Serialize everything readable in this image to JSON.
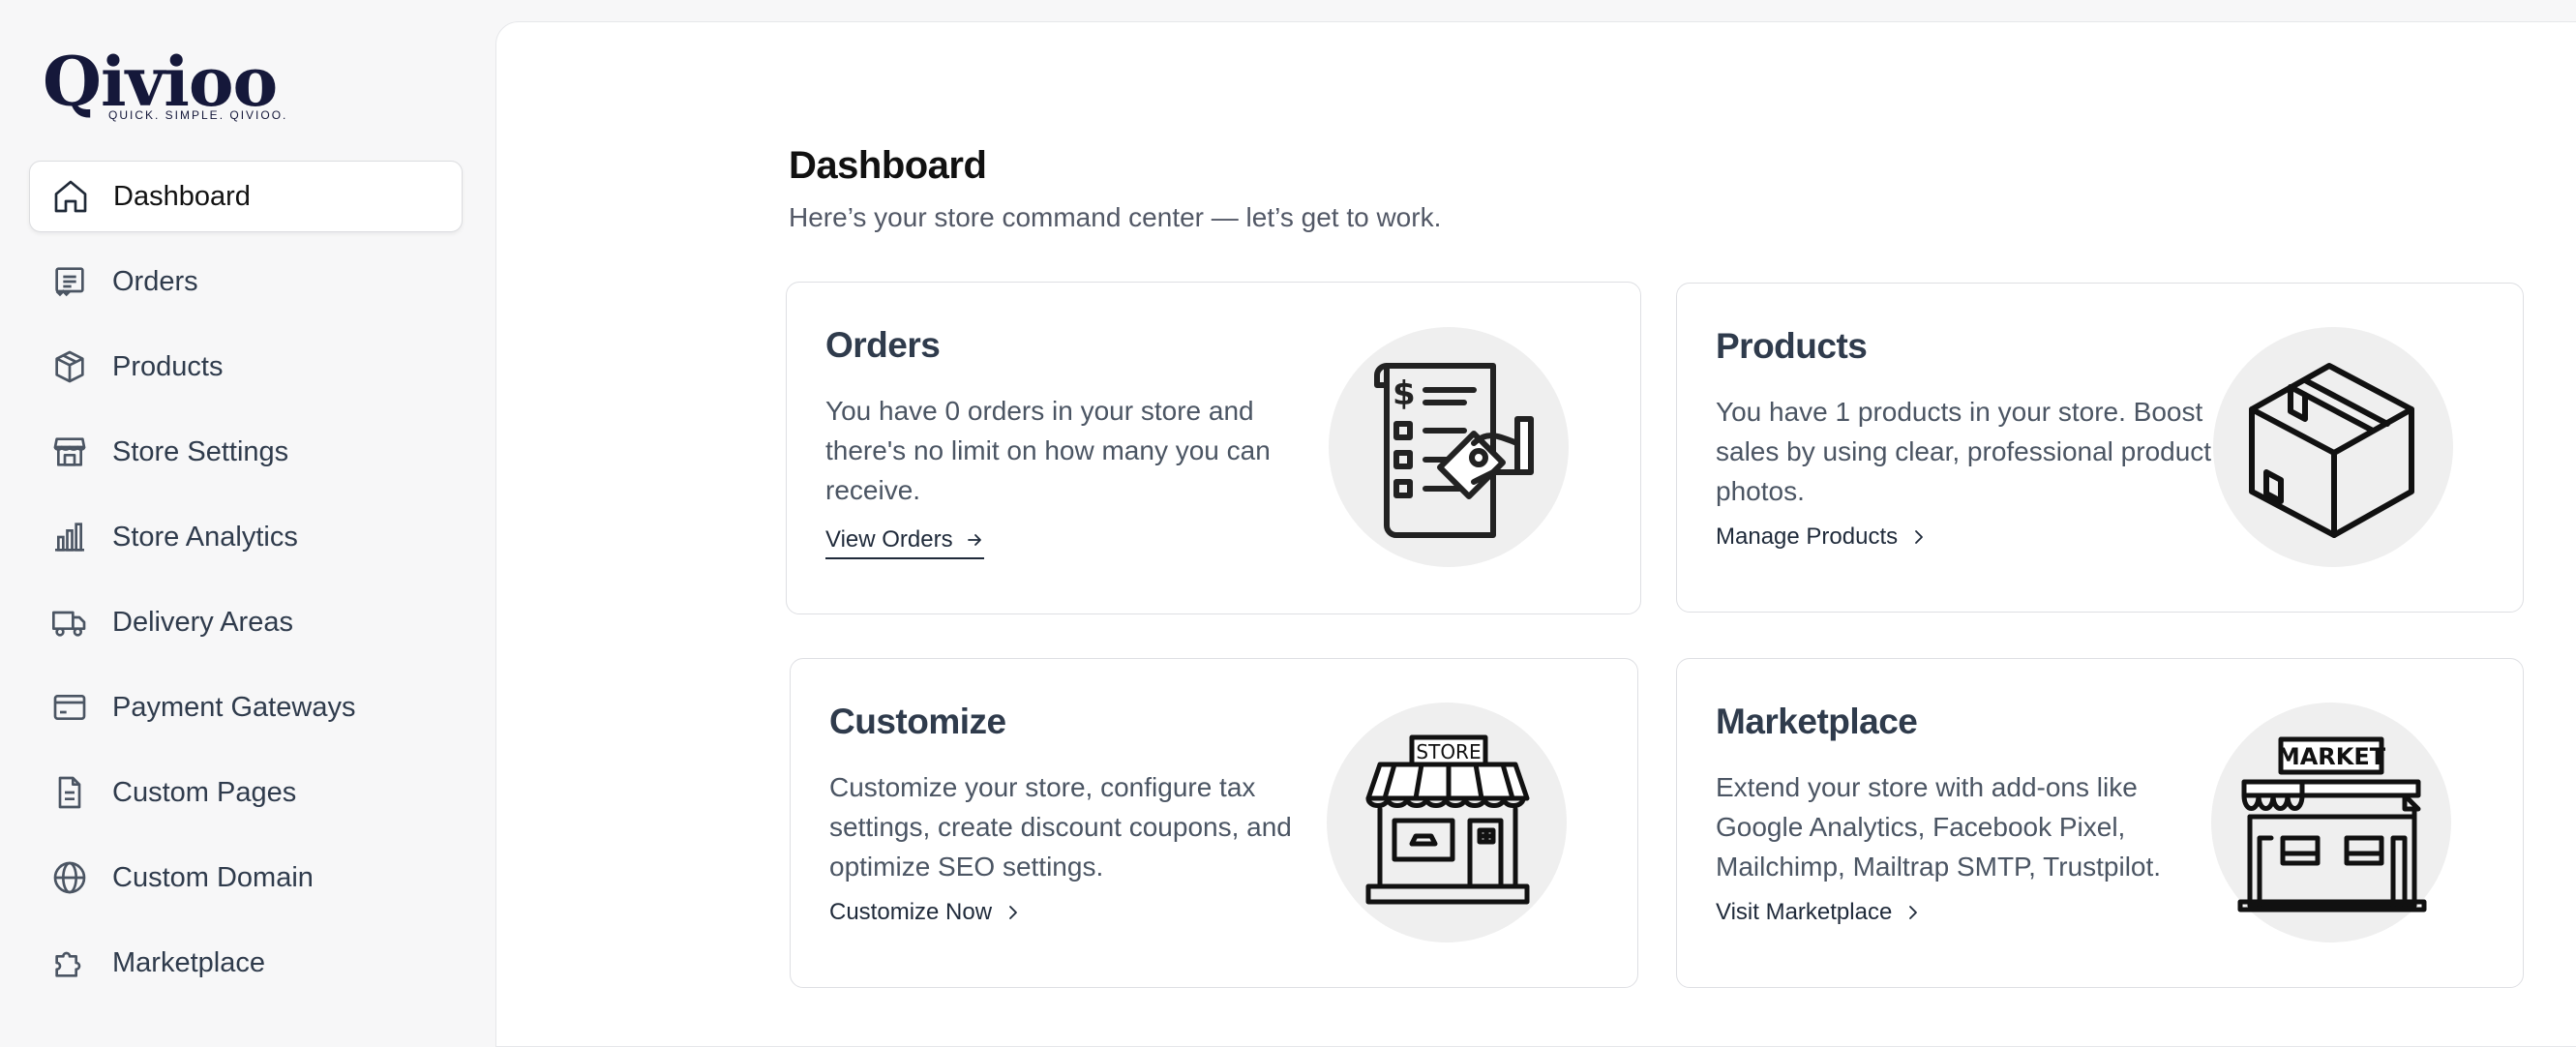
{
  "brand": {
    "name": "Qivioo",
    "tagline": "QUICK. SIMPLE. QIVIOO."
  },
  "sidebar": {
    "items": [
      {
        "label": "Dashboard",
        "icon": "home-icon",
        "active": true
      },
      {
        "label": "Orders",
        "icon": "receipt-icon"
      },
      {
        "label": "Products",
        "icon": "box-icon"
      },
      {
        "label": "Store Settings",
        "icon": "storefront-icon"
      },
      {
        "label": "Store Analytics",
        "icon": "bar-chart-icon"
      },
      {
        "label": "Delivery Areas",
        "icon": "truck-icon"
      },
      {
        "label": "Payment Gateways",
        "icon": "credit-card-icon"
      },
      {
        "label": "Custom Pages",
        "icon": "document-icon"
      },
      {
        "label": "Custom Domain",
        "icon": "globe-icon"
      },
      {
        "label": "Marketplace",
        "icon": "puzzle-icon"
      }
    ]
  },
  "main": {
    "title": "Dashboard",
    "subtitle": "Here’s your store command center — let’s get to work.",
    "cards": {
      "orders": {
        "title": "Orders",
        "text": "You have 0 orders in your store and there's no limit on how many you can receive.",
        "link": "View Orders",
        "illustration": "order-receipt-illustration"
      },
      "products": {
        "title": "Products",
        "text": "You have 1 products in your store. Boost sales by using clear, professional product photos.",
        "link": "Manage Products",
        "illustration": "package-box-illustration"
      },
      "customize": {
        "title": "Customize",
        "text": "Customize your store, configure tax settings, create discount coupons, and optimize SEO settings.",
        "link": "Customize Now",
        "illustration": "store-illustration",
        "sign": "STORE"
      },
      "marketplace": {
        "title": "Marketplace",
        "text": "Extend your store with add-ons like Google Analytics, Facebook Pixel, Mailchimp, Mailtrap SMTP, Trustpilot.",
        "link": "Visit Marketplace",
        "illustration": "market-illustration",
        "sign": "MARKET"
      }
    }
  },
  "colors": {
    "background": "#f7f7f8",
    "panel": "#ffffff",
    "heading": "#2f3b4c",
    "body_text": "#4b5563",
    "brand": "#15183a"
  }
}
